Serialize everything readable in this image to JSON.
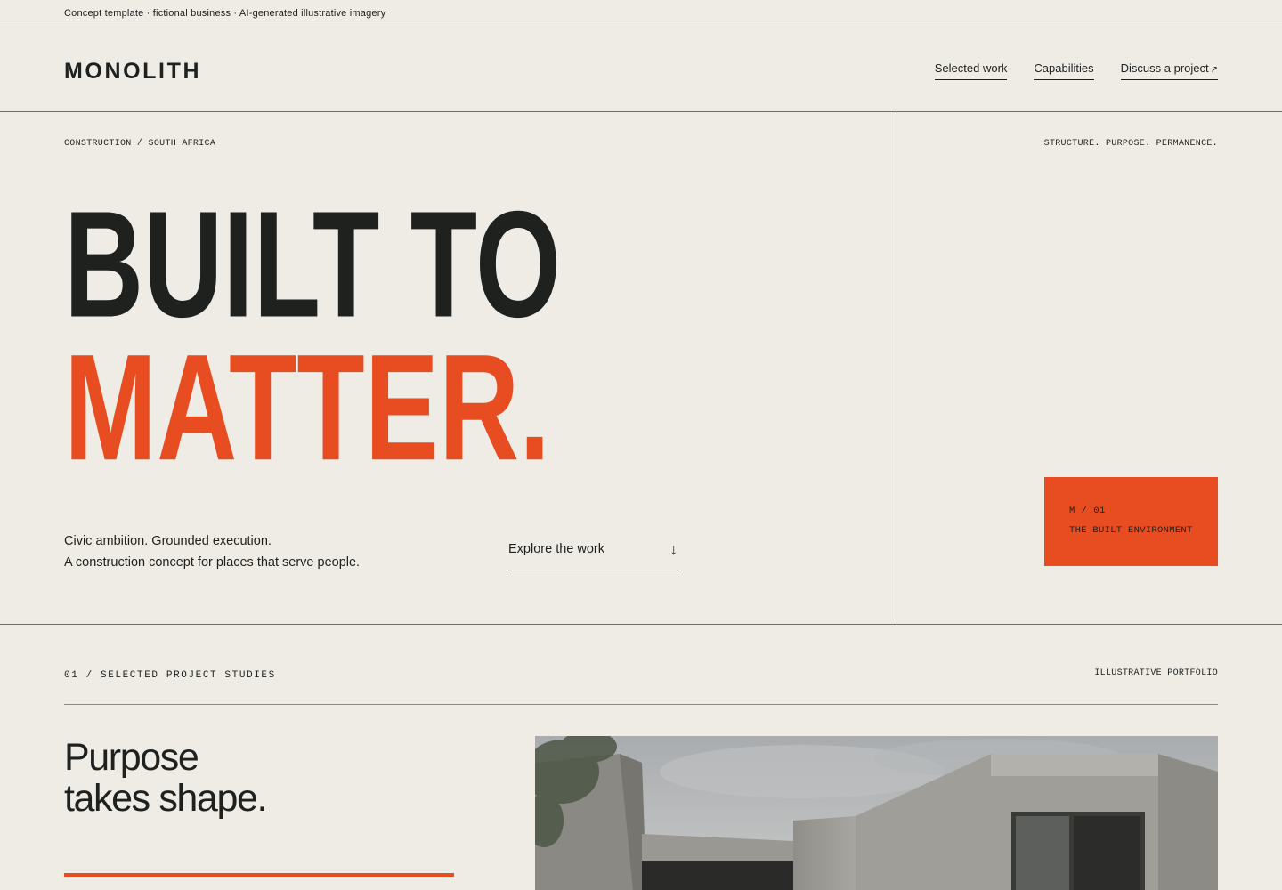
{
  "topbar": {
    "notice": "Concept template · fictional business · AI-generated illustrative imagery"
  },
  "header": {
    "logo": "MONOLITH",
    "nav": [
      {
        "label": "Selected work"
      },
      {
        "label": "Capabilities"
      },
      {
        "label": "Discuss a project",
        "icon": "arrow-up-right-icon"
      }
    ]
  },
  "hero": {
    "eyebrow": "CONSTRUCTION / SOUTH AFRICA",
    "tagline": "STRUCTURE. PURPOSE. PERMANENCE.",
    "headline_line1": "BUILT TO",
    "headline_line2": "MATTER.",
    "copy_line1": "Civic ambition. Grounded execution.",
    "copy_line2": "A construction concept for places that serve people.",
    "cta_label": "Explore the work",
    "cta_icon": "↓",
    "card_code": "M / 01",
    "card_title": "THE BUILT ENVIRONMENT"
  },
  "section": {
    "label": "01 / SELECTED PROJECT STUDIES",
    "right_label": "ILLUSTRATIVE PORTFOLIO",
    "heading_line1": "Purpose",
    "heading_line2": "takes shape."
  },
  "colors": {
    "background": "#eeece5",
    "ink": "#1f211f",
    "accent": "#e84d21"
  }
}
